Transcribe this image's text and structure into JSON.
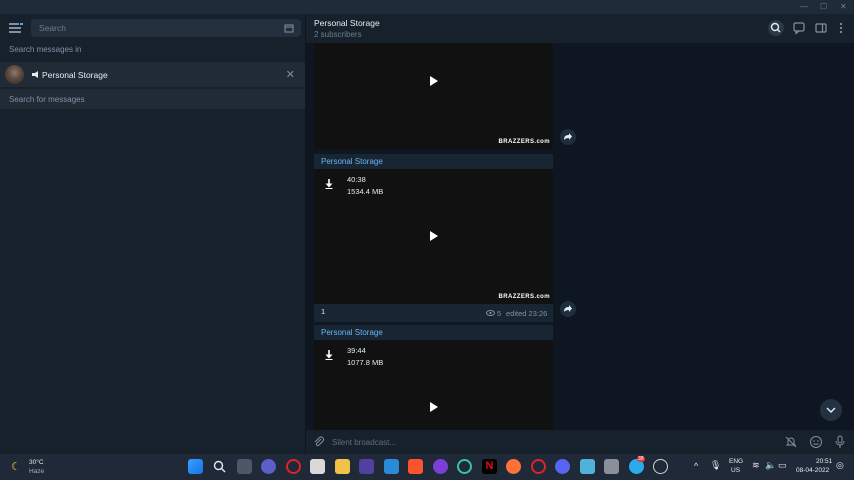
{
  "window": {
    "minimize": "—",
    "maximize": "☐",
    "close": "✕"
  },
  "sidebar": {
    "search_placeholder": "Search",
    "search_in_label": "Search messages in",
    "chat_name": "Personal Storage",
    "search_for_label": "Search for messages"
  },
  "header": {
    "title": "Personal Storage",
    "subtitle": "2 subscribers"
  },
  "messages": [
    {
      "watermark": "BRAZZERS.com"
    },
    {
      "sender": "Personal Storage",
      "duration": "40:38",
      "size": "1534.4 MB",
      "watermark": "BRAZZERS.com",
      "caption": "1",
      "views": "5",
      "edited": "edited 23:26"
    },
    {
      "sender": "Personal Storage",
      "duration": "39:44",
      "size": "1077.8 MB"
    }
  ],
  "composer": {
    "placeholder": "Silent broadcast..."
  },
  "taskbar": {
    "weather_temp": "30°C",
    "weather_desc": "Haze",
    "lang": "ENG",
    "region": "US",
    "time": "20:51",
    "date": "08-04-2022",
    "telegram_badge": "38"
  },
  "colors": {
    "accent": "#6ab3f3",
    "panel": "#17212b",
    "chat_bg": "#0e1621",
    "bubble": "#182533"
  }
}
